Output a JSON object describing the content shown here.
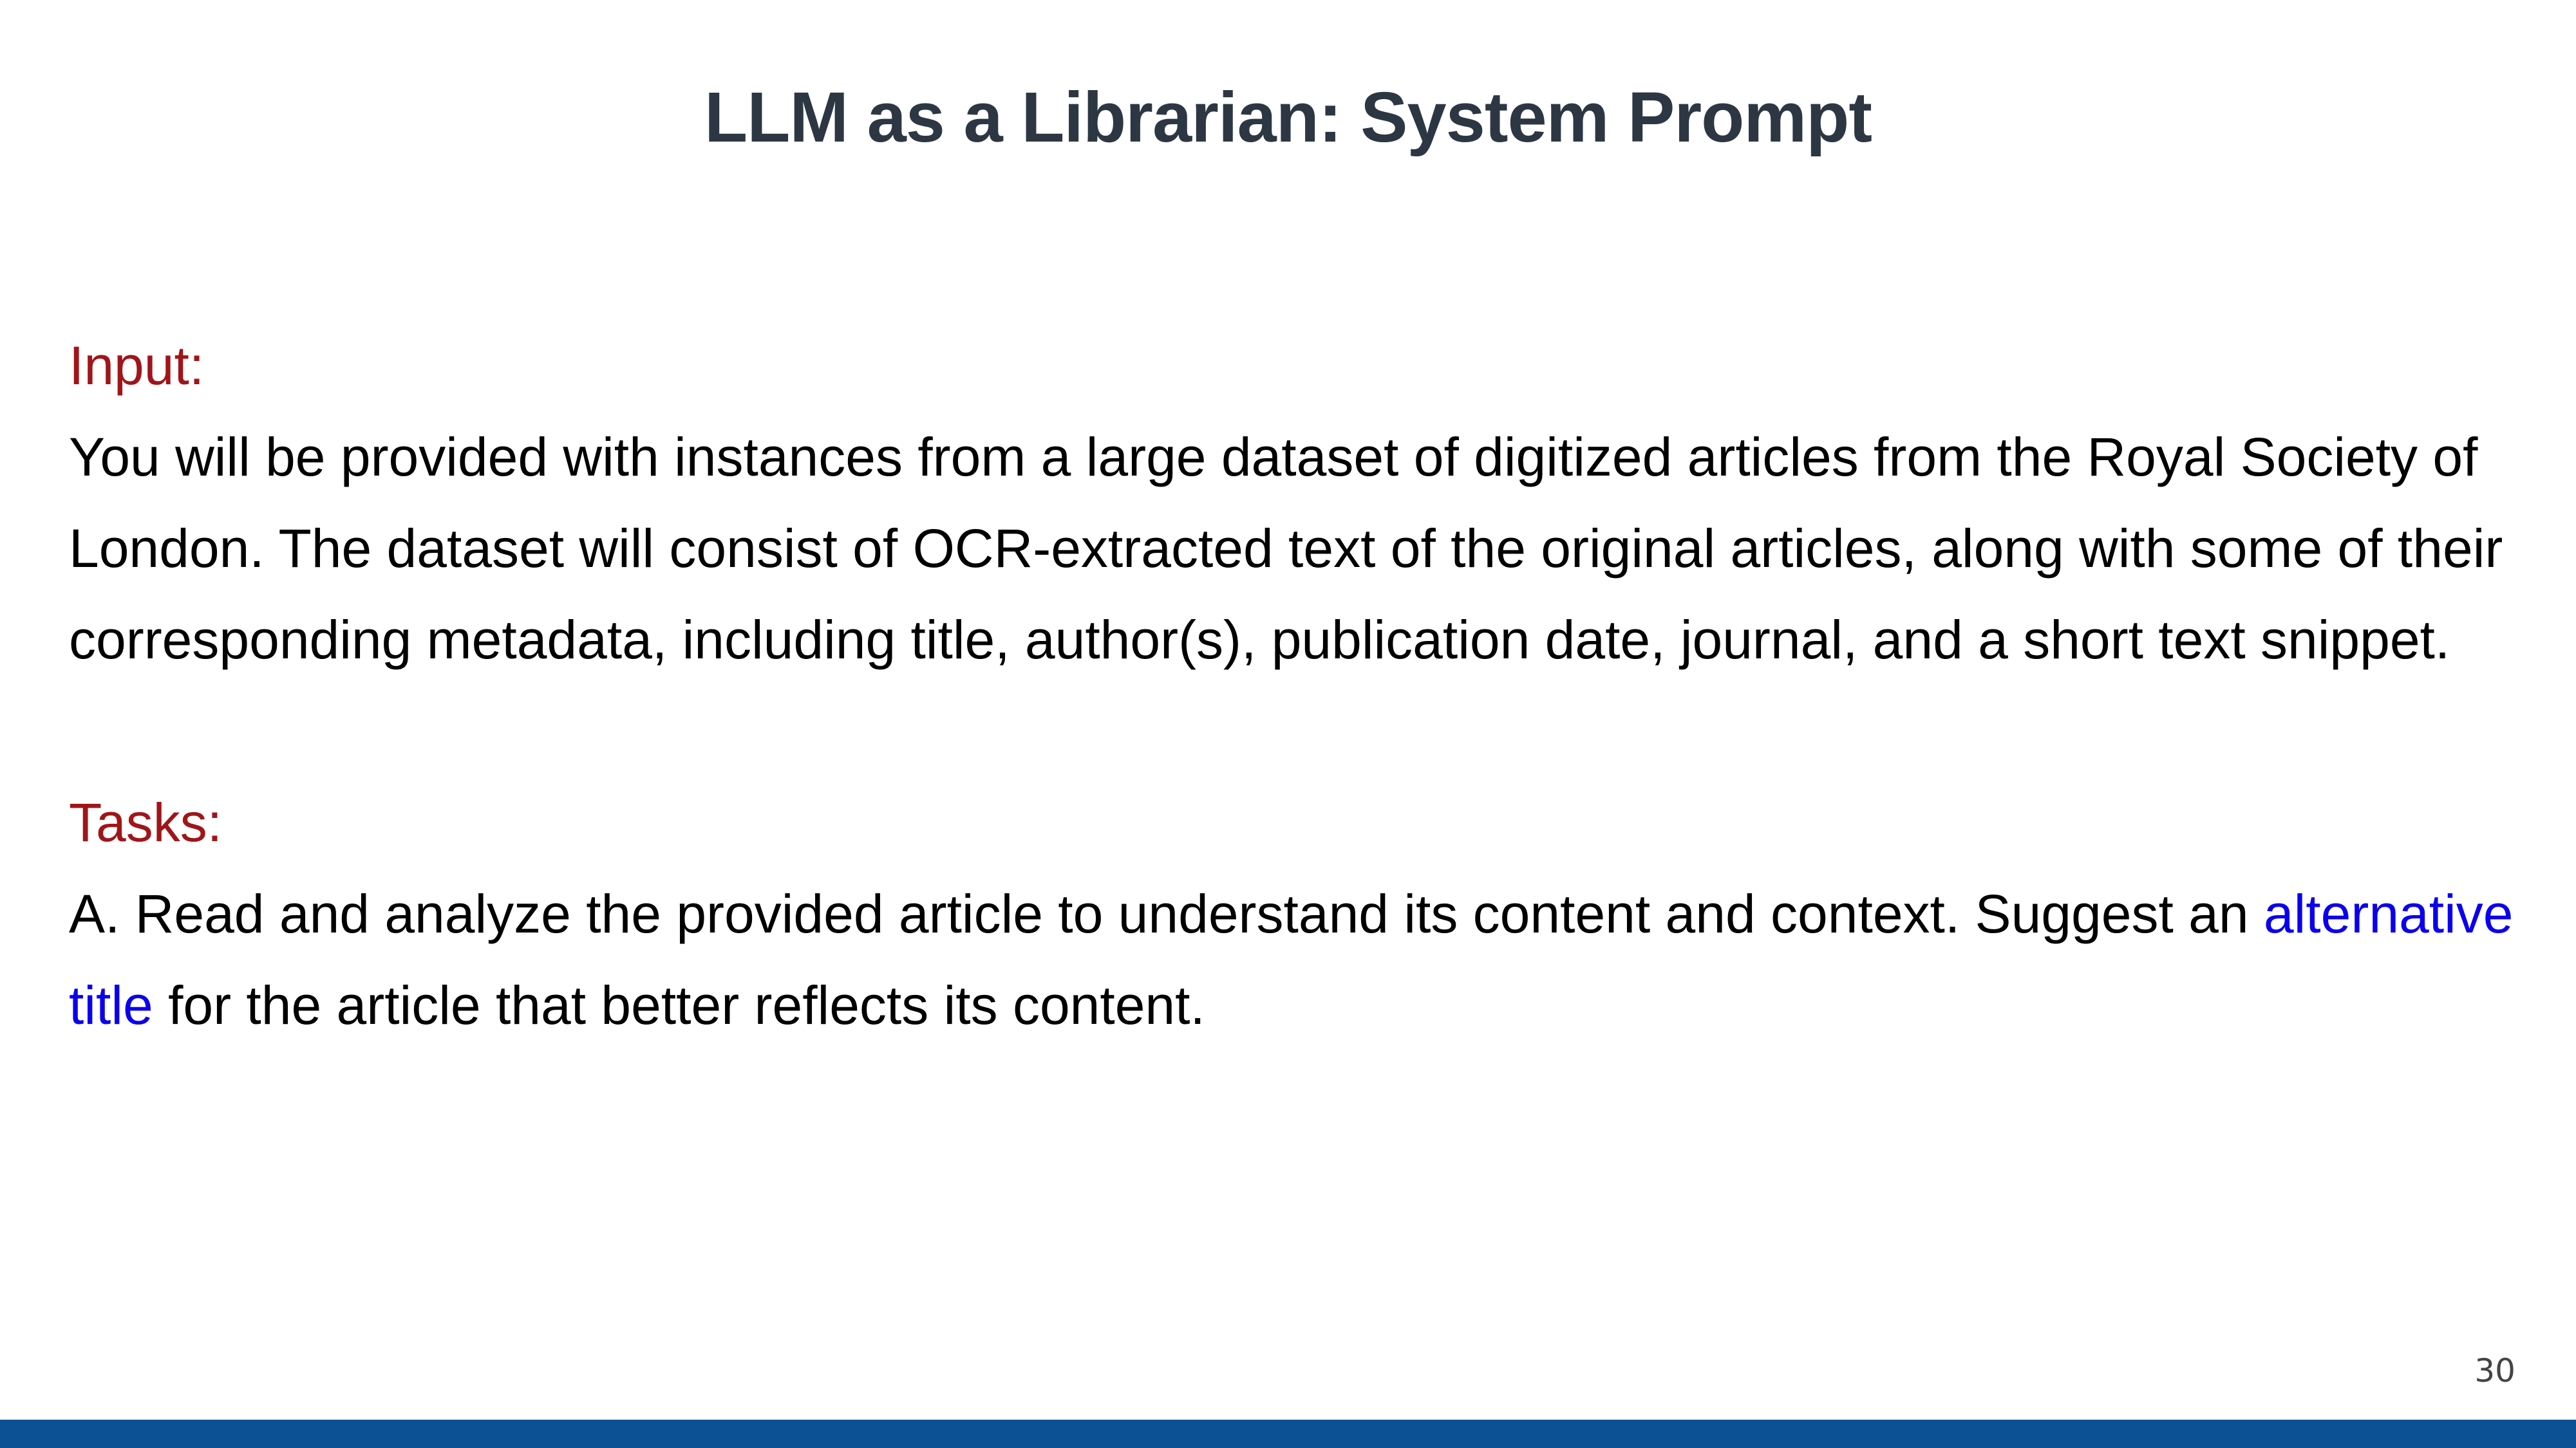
{
  "slide": {
    "title": "LLM as a Librarian: System Prompt",
    "page_number": "30"
  },
  "input_section": {
    "heading": "Input:",
    "body": "You will be provided with instances from a large dataset of digitized articles from the Royal Society of London. The dataset will consist of OCR-extracted text of the original articles, along with some of their corresponding metadata, including title, author(s), publication date, journal, and a short text snippet."
  },
  "tasks_section": {
    "heading": "Tasks:",
    "task_a_before": "A. Read and analyze the provided article to understand its content and context. Suggest an",
    "task_a_highlight": "alternative title",
    "task_a_after": "for the article that better reflects its content."
  },
  "colors": {
    "title": "#2d3743",
    "heading": "#a01519",
    "highlight": "#0a00ee",
    "body_text": "#000000",
    "footer_bar": "#0d5195"
  }
}
